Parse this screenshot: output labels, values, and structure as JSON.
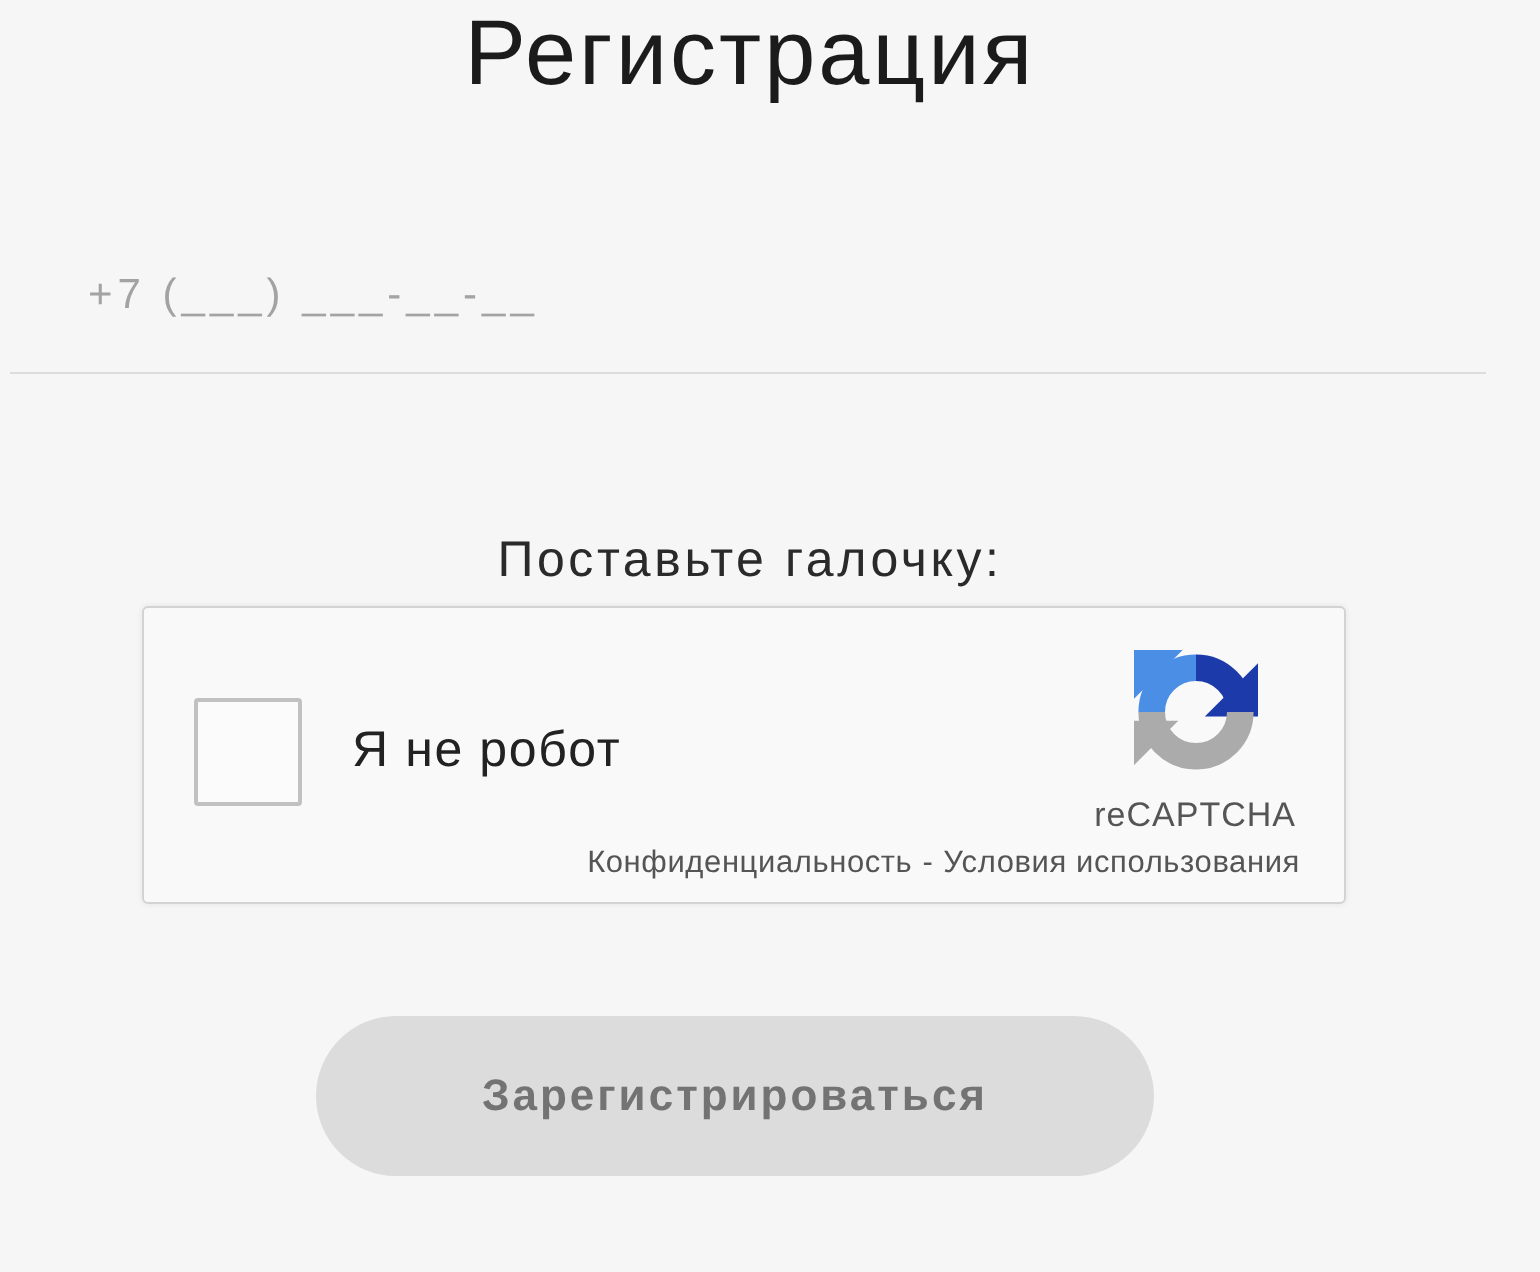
{
  "title": "Регистрация",
  "phone_field": {
    "placeholder": "+7 (___) ___-__-__"
  },
  "captcha_prompt": "Поставьте галочку:",
  "recaptcha": {
    "checkbox": {
      "label": "Я не робот",
      "checked": false
    },
    "brand": "reCAPTCHA",
    "links": [
      {
        "label": "Конфиденциальность"
      },
      {
        "label": "Условия использования"
      }
    ],
    "separator": "-"
  },
  "submit_button": {
    "label": "Зарегистрироваться",
    "disabled": true
  }
}
